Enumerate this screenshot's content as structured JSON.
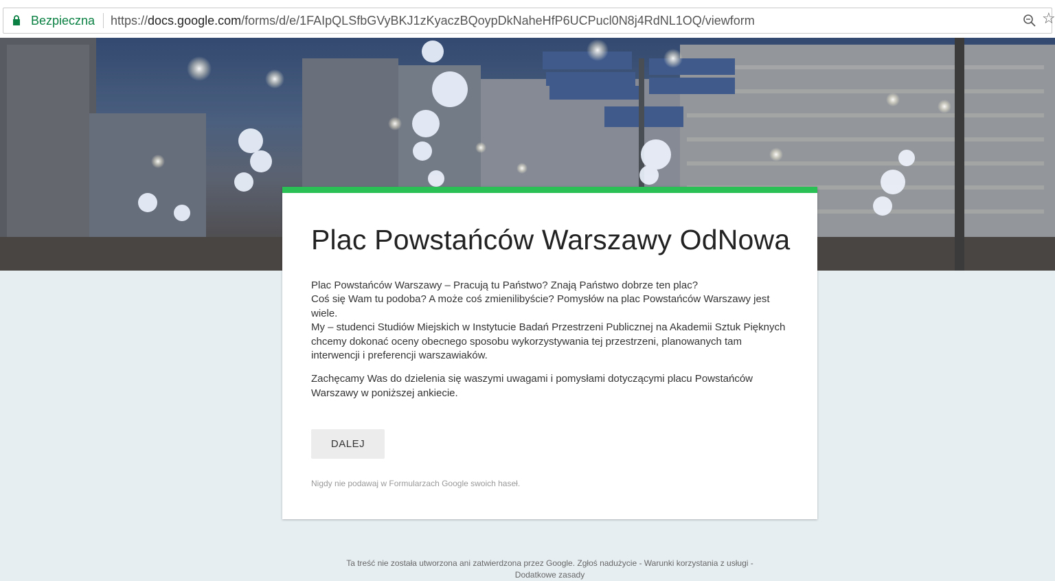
{
  "address_bar": {
    "secure_label": "Bezpieczna",
    "url_prefix": "https://",
    "url_domain": "docs.google.com",
    "url_path": "/forms/d/e/1FAIpQLSfbGVyBKJ1zKyaczBQoypDkNaheHfP6UCPucl0N8j4RdNL1OQ/viewform",
    "secure_color": "#0b8043"
  },
  "form": {
    "accent_color": "#2ac055",
    "title": "Plac Powstańców Warszawy OdNowa",
    "description": [
      "Plac Powstańców Warszawy – Pracują tu Państwo? Znają Państwo dobrze ten plac?",
      "Coś się Wam tu podoba? A może coś zmienilibyście? Pomysłów na plac Powstańców Warszawy jest wiele.",
      "My – studenci Studiów Miejskich w Instytucie Badań Przestrzeni Publicznej na Akademii Sztuk Pięknych chcemy dokonać oceny obecnego sposobu wykorzystywania tej przestrzeni, planowanych tam interwencji i preferencji warszawiaków.",
      "Zachęcamy Was do dzielenia się waszymi uwagami i pomysłami dotyczącymi placu Powstańców Warszawy w poniższej ankiecie."
    ],
    "next_button": "DALEJ",
    "password_warning": "Nigdy nie podawaj w Formularzach Google swoich haseł."
  },
  "footer": {
    "disclaimer": "Ta treść nie została utworzona ani zatwierdzona przez Google.",
    "report_link": "Zgłoś nadużycie",
    "terms_link": "Warunki korzystania z usługi",
    "extra_link": "Dodatkowe zasady"
  }
}
